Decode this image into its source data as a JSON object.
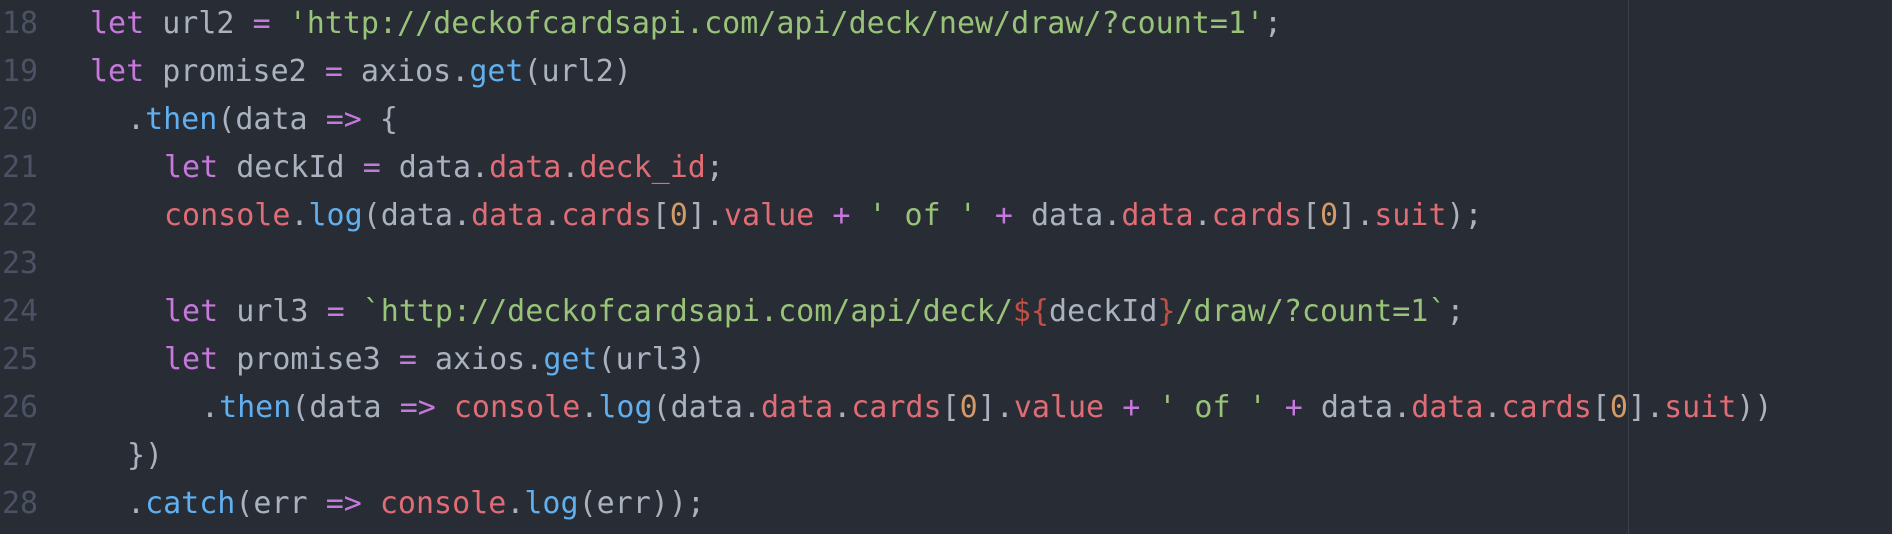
{
  "editor": {
    "colors": {
      "background": "#282c34",
      "gutter": "#4b5263",
      "keyword": "#c678dd",
      "string": "#98c379",
      "function": "#61afef",
      "property": "#e06c75",
      "number": "#d19a66",
      "plain": "#abb2bf"
    },
    "lines": [
      {
        "num": "18",
        "indent": 0,
        "tokens": [
          {
            "t": "kw",
            "v": "let"
          },
          {
            "t": "plain",
            "v": " url2 "
          },
          {
            "t": "op",
            "v": "="
          },
          {
            "t": "plain",
            "v": " "
          },
          {
            "t": "str",
            "v": "'http://deckofcardsapi.com/api/deck/new/draw/?count=1'"
          },
          {
            "t": "plain",
            "v": ";"
          }
        ]
      },
      {
        "num": "19",
        "indent": 0,
        "tokens": [
          {
            "t": "kw",
            "v": "let"
          },
          {
            "t": "plain",
            "v": " promise2 "
          },
          {
            "t": "op",
            "v": "="
          },
          {
            "t": "plain",
            "v": " axios."
          },
          {
            "t": "fn",
            "v": "get"
          },
          {
            "t": "plain",
            "v": "(url2)"
          }
        ]
      },
      {
        "num": "20",
        "indent": 2,
        "tokens": [
          {
            "t": "plain",
            "v": "."
          },
          {
            "t": "fn",
            "v": "then"
          },
          {
            "t": "plain",
            "v": "(data "
          },
          {
            "t": "op",
            "v": "=>"
          },
          {
            "t": "plain",
            "v": " {"
          }
        ]
      },
      {
        "num": "21",
        "indent": 4,
        "tokens": [
          {
            "t": "kw",
            "v": "let"
          },
          {
            "t": "plain",
            "v": " deckId "
          },
          {
            "t": "op",
            "v": "="
          },
          {
            "t": "plain",
            "v": " data."
          },
          {
            "t": "obj",
            "v": "data"
          },
          {
            "t": "plain",
            "v": "."
          },
          {
            "t": "obj",
            "v": "deck_id"
          },
          {
            "t": "plain",
            "v": ";"
          }
        ]
      },
      {
        "num": "22",
        "indent": 4,
        "tokens": [
          {
            "t": "obj",
            "v": "console"
          },
          {
            "t": "plain",
            "v": "."
          },
          {
            "t": "fn",
            "v": "log"
          },
          {
            "t": "plain",
            "v": "(data."
          },
          {
            "t": "obj",
            "v": "data"
          },
          {
            "t": "plain",
            "v": "."
          },
          {
            "t": "obj",
            "v": "cards"
          },
          {
            "t": "plain",
            "v": "["
          },
          {
            "t": "num",
            "v": "0"
          },
          {
            "t": "plain",
            "v": "]."
          },
          {
            "t": "obj",
            "v": "value"
          },
          {
            "t": "plain",
            "v": " "
          },
          {
            "t": "op",
            "v": "+"
          },
          {
            "t": "plain",
            "v": " "
          },
          {
            "t": "str",
            "v": "' of '"
          },
          {
            "t": "plain",
            "v": " "
          },
          {
            "t": "op",
            "v": "+"
          },
          {
            "t": "plain",
            "v": " data."
          },
          {
            "t": "obj",
            "v": "data"
          },
          {
            "t": "plain",
            "v": "."
          },
          {
            "t": "obj",
            "v": "cards"
          },
          {
            "t": "plain",
            "v": "["
          },
          {
            "t": "num",
            "v": "0"
          },
          {
            "t": "plain",
            "v": "]."
          },
          {
            "t": "obj",
            "v": "suit"
          },
          {
            "t": "plain",
            "v": ");"
          }
        ]
      },
      {
        "num": "23",
        "indent": 0,
        "tokens": []
      },
      {
        "num": "24",
        "indent": 4,
        "tokens": [
          {
            "t": "kw",
            "v": "let"
          },
          {
            "t": "plain",
            "v": " url3 "
          },
          {
            "t": "op",
            "v": "="
          },
          {
            "t": "plain",
            "v": " "
          },
          {
            "t": "str",
            "v": "`http://deckofcardsapi.com/api/deck/"
          },
          {
            "t": "interp",
            "v": "${"
          },
          {
            "t": "plain",
            "v": "deckId"
          },
          {
            "t": "interp",
            "v": "}"
          },
          {
            "t": "str",
            "v": "/draw/?count=1`"
          },
          {
            "t": "plain",
            "v": ";"
          }
        ]
      },
      {
        "num": "25",
        "indent": 4,
        "tokens": [
          {
            "t": "kw",
            "v": "let"
          },
          {
            "t": "plain",
            "v": " promise3 "
          },
          {
            "t": "op",
            "v": "="
          },
          {
            "t": "plain",
            "v": " axios."
          },
          {
            "t": "fn",
            "v": "get"
          },
          {
            "t": "plain",
            "v": "(url3)"
          }
        ]
      },
      {
        "num": "26",
        "indent": 6,
        "tokens": [
          {
            "t": "plain",
            "v": "."
          },
          {
            "t": "fn",
            "v": "then"
          },
          {
            "t": "plain",
            "v": "(data "
          },
          {
            "t": "op",
            "v": "=>"
          },
          {
            "t": "plain",
            "v": " "
          },
          {
            "t": "obj",
            "v": "console"
          },
          {
            "t": "plain",
            "v": "."
          },
          {
            "t": "fn",
            "v": "log"
          },
          {
            "t": "plain",
            "v": "(data."
          },
          {
            "t": "obj",
            "v": "data"
          },
          {
            "t": "plain",
            "v": "."
          },
          {
            "t": "obj",
            "v": "cards"
          },
          {
            "t": "plain",
            "v": "["
          },
          {
            "t": "num",
            "v": "0"
          },
          {
            "t": "plain",
            "v": "]."
          },
          {
            "t": "obj",
            "v": "value"
          },
          {
            "t": "plain",
            "v": " "
          },
          {
            "t": "op",
            "v": "+"
          },
          {
            "t": "plain",
            "v": " "
          },
          {
            "t": "str",
            "v": "' of '"
          },
          {
            "t": "plain",
            "v": " "
          },
          {
            "t": "op",
            "v": "+"
          },
          {
            "t": "plain",
            "v": " data."
          },
          {
            "t": "obj",
            "v": "data"
          },
          {
            "t": "plain",
            "v": "."
          },
          {
            "t": "obj",
            "v": "cards"
          },
          {
            "t": "plain",
            "v": "["
          },
          {
            "t": "num",
            "v": "0"
          },
          {
            "t": "plain",
            "v": "]."
          },
          {
            "t": "obj",
            "v": "suit"
          },
          {
            "t": "plain",
            "v": "))"
          }
        ]
      },
      {
        "num": "27",
        "indent": 2,
        "tokens": [
          {
            "t": "plain",
            "v": "})"
          }
        ]
      },
      {
        "num": "28",
        "indent": 2,
        "tokens": [
          {
            "t": "plain",
            "v": "."
          },
          {
            "t": "fn",
            "v": "catch"
          },
          {
            "t": "plain",
            "v": "(err "
          },
          {
            "t": "op",
            "v": "=>"
          },
          {
            "t": "plain",
            "v": " "
          },
          {
            "t": "obj",
            "v": "console"
          },
          {
            "t": "plain",
            "v": "."
          },
          {
            "t": "fn",
            "v": "log"
          },
          {
            "t": "plain",
            "v": "(err));"
          }
        ]
      }
    ]
  }
}
